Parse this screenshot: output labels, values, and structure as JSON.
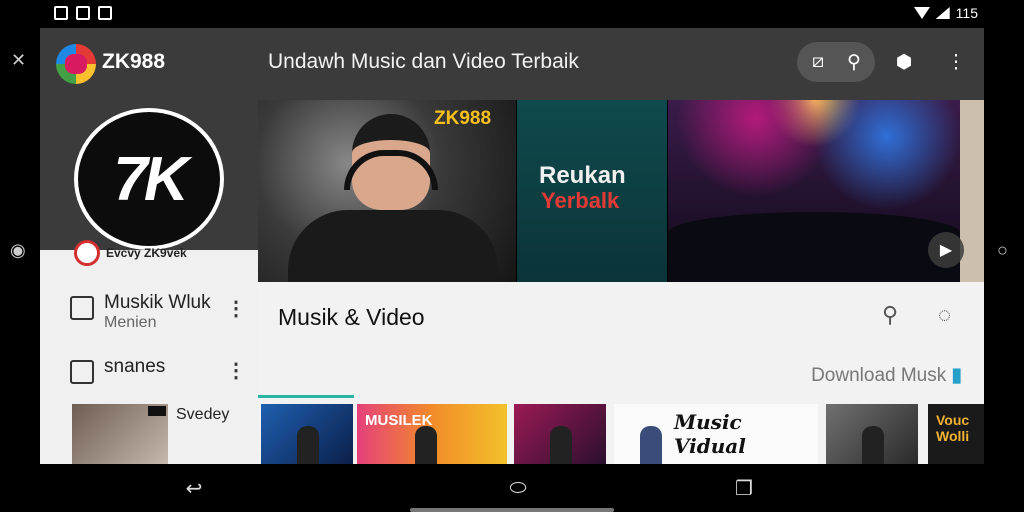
{
  "statusbar": {
    "time": "115"
  },
  "appbar": {
    "brand": "ZK988",
    "title": "Undawh Music dan Video Terbaik"
  },
  "left_panel": {
    "logo_text": "7K",
    "channel_name": "Evcvy ZK9vek",
    "menu": [
      {
        "label": "Muskik Wluk",
        "sub": "Menien"
      },
      {
        "label": "snanes",
        "sub": ""
      }
    ],
    "thumb_label": "Svedey"
  },
  "hero": {
    "badge": "ZK988",
    "promo_line1": "Reukan",
    "promo_line2": "Yerbalk"
  },
  "content": {
    "title": "Musik & Video",
    "download_label": "Download Musk",
    "tiles": [
      {
        "label": ""
      },
      {
        "label": "MUSILEK"
      },
      {
        "label": ""
      },
      {
        "label": "Music Vidual"
      },
      {
        "label": ""
      },
      {
        "label": "Vouc Wolli"
      }
    ]
  },
  "icons": {
    "status": [
      "notification-icon",
      "photo-icon",
      "wifi-icon",
      "battery-icon"
    ],
    "appbar": [
      "cast-icon",
      "search-icon",
      "account-icon",
      "more-vertical-icon"
    ],
    "nav": [
      "back-icon",
      "home-icon",
      "recents-icon"
    ]
  }
}
